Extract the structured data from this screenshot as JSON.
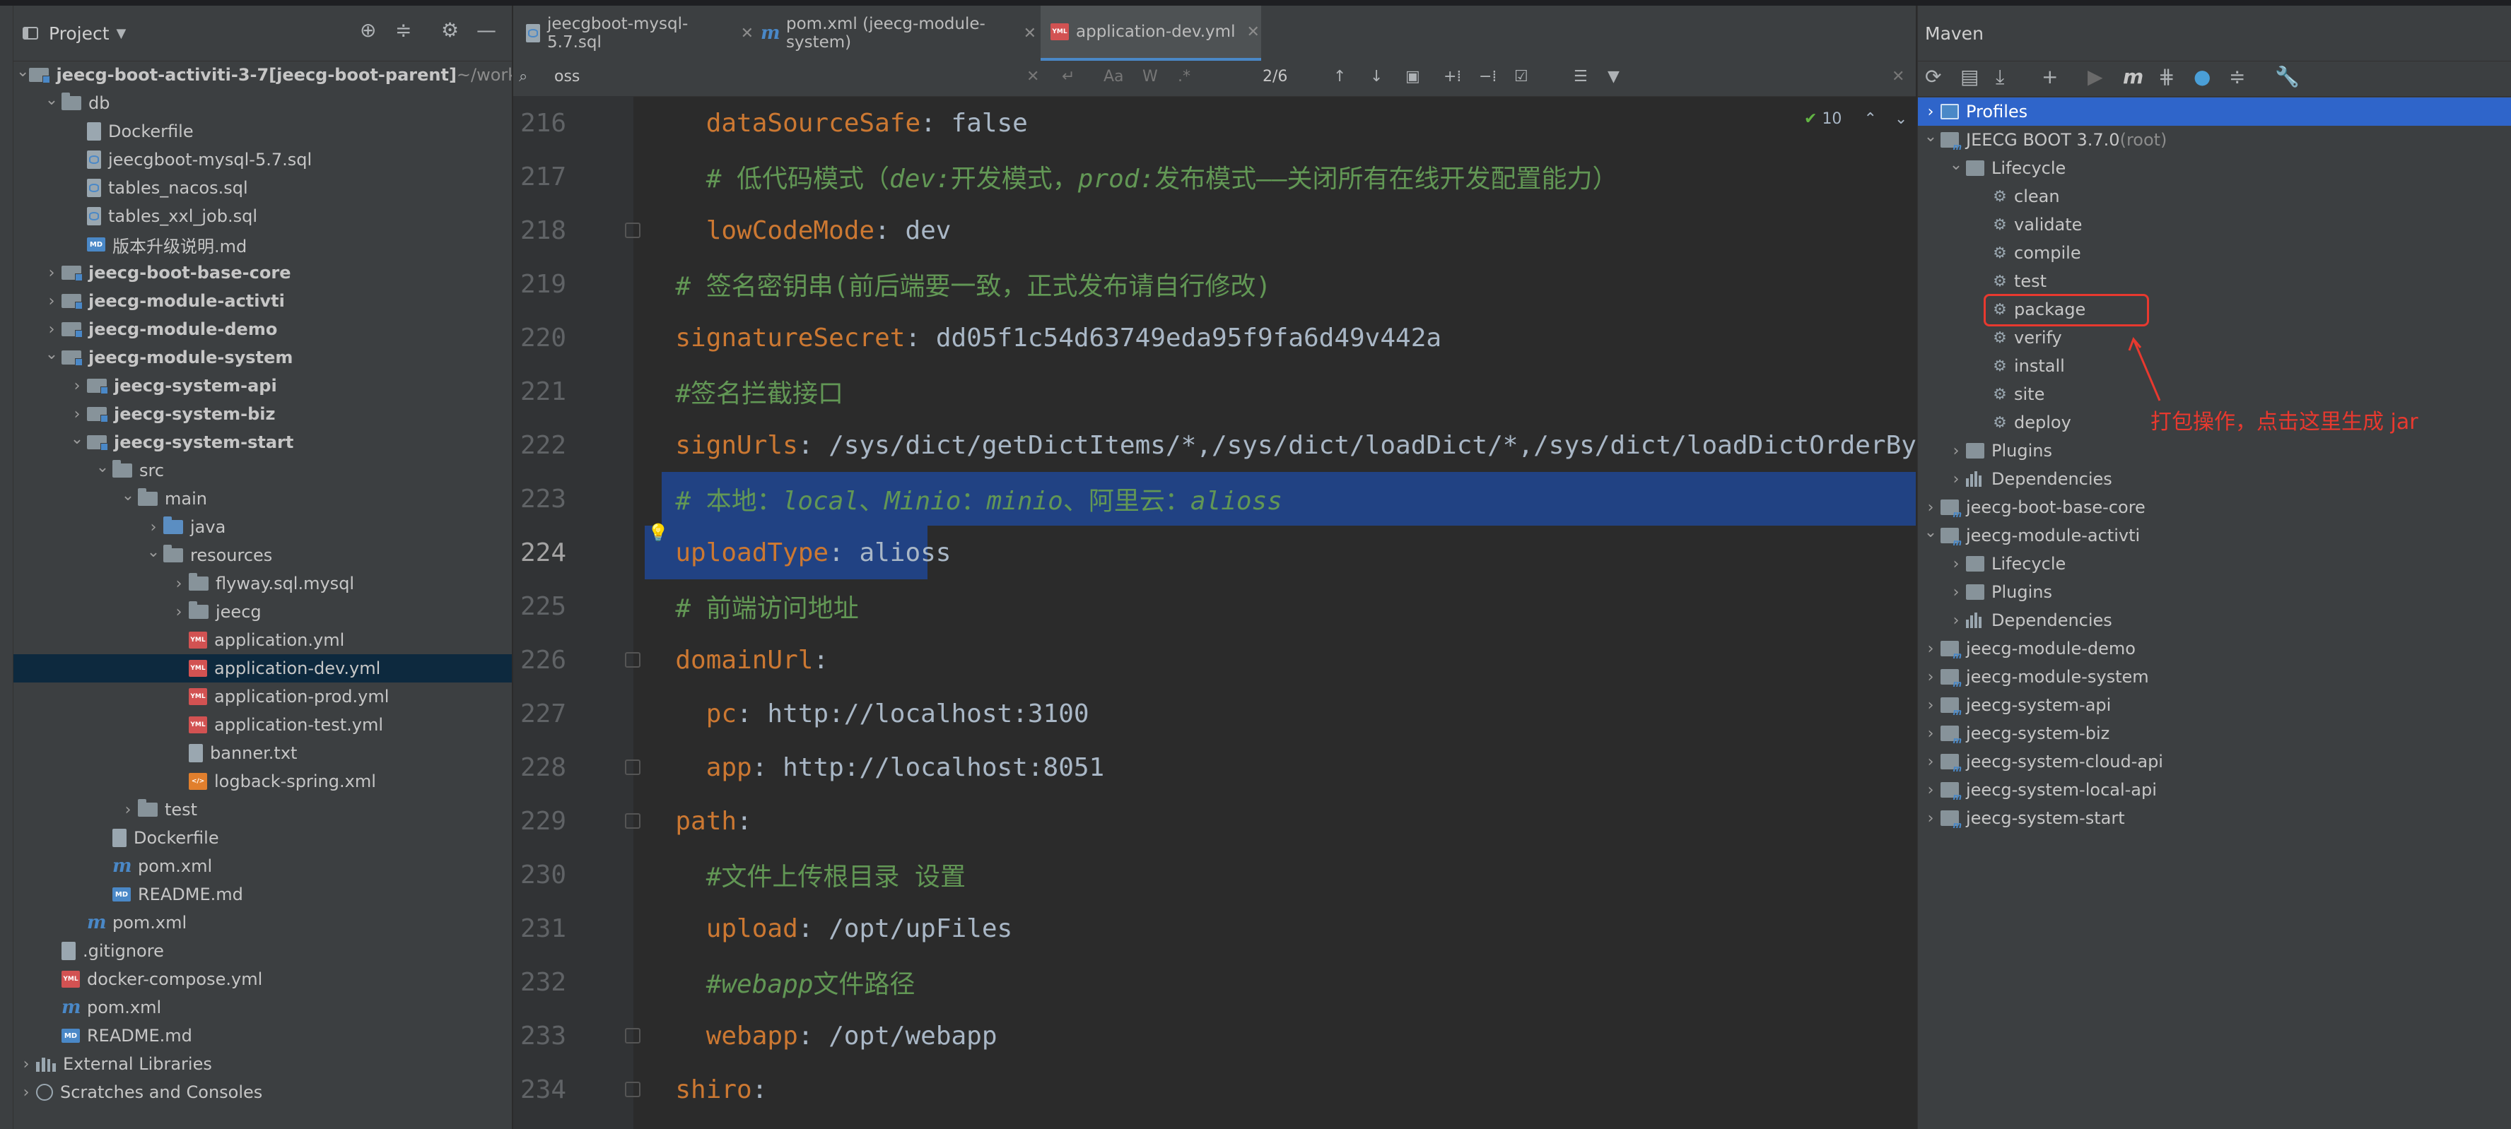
{
  "project_panel": {
    "title": "Project",
    "tree": [
      {
        "label": "jeecg-boot-activiti-3-7",
        "extra": " [jeecg-boot-parent]",
        "hint": " ~/worksp",
        "depth": 0,
        "arrow": "open",
        "icon": "module-folder",
        "bold": true
      },
      {
        "label": "db",
        "depth": 1,
        "arrow": "open",
        "icon": "folder"
      },
      {
        "label": "Dockerfile",
        "depth": 2,
        "arrow": "none",
        "icon": "file"
      },
      {
        "label": "jeecgboot-mysql-5.7.sql",
        "depth": 2,
        "arrow": "none",
        "icon": "sql-file"
      },
      {
        "label": "tables_nacos.sql",
        "depth": 2,
        "arrow": "none",
        "icon": "sql-file"
      },
      {
        "label": "tables_xxl_job.sql",
        "depth": 2,
        "arrow": "none",
        "icon": "sql-file"
      },
      {
        "label": "版本升级说明.md",
        "depth": 2,
        "arrow": "none",
        "icon": "md-file"
      },
      {
        "label": "jeecg-boot-base-core",
        "depth": 1,
        "arrow": "closed",
        "icon": "module-folder",
        "bold": true
      },
      {
        "label": "jeecg-module-activti",
        "depth": 1,
        "arrow": "closed",
        "icon": "module-folder",
        "bold": true
      },
      {
        "label": "jeecg-module-demo",
        "depth": 1,
        "arrow": "closed",
        "icon": "module-folder",
        "bold": true
      },
      {
        "label": "jeecg-module-system",
        "depth": 1,
        "arrow": "open",
        "icon": "module-folder",
        "bold": true
      },
      {
        "label": "jeecg-system-api",
        "depth": 2,
        "arrow": "closed",
        "icon": "module-folder",
        "bold": true
      },
      {
        "label": "jeecg-system-biz",
        "depth": 2,
        "arrow": "closed",
        "icon": "module-folder",
        "bold": true
      },
      {
        "label": "jeecg-system-start",
        "depth": 2,
        "arrow": "open",
        "icon": "module-folder",
        "bold": true
      },
      {
        "label": "src",
        "depth": 3,
        "arrow": "open",
        "icon": "folder"
      },
      {
        "label": "main",
        "depth": 4,
        "arrow": "open",
        "icon": "folder"
      },
      {
        "label": "java",
        "depth": 5,
        "arrow": "closed",
        "icon": "folder-blue"
      },
      {
        "label": "resources",
        "depth": 5,
        "arrow": "open",
        "icon": "folder"
      },
      {
        "label": "flyway.sql.mysql",
        "depth": 6,
        "arrow": "closed",
        "icon": "folder"
      },
      {
        "label": "jeecg",
        "depth": 6,
        "arrow": "closed",
        "icon": "folder"
      },
      {
        "label": "application.yml",
        "depth": 6,
        "arrow": "none",
        "icon": "yml-file"
      },
      {
        "label": "application-dev.yml",
        "depth": 6,
        "arrow": "none",
        "icon": "yml-file",
        "selected": true
      },
      {
        "label": "application-prod.yml",
        "depth": 6,
        "arrow": "none",
        "icon": "yml-file"
      },
      {
        "label": "application-test.yml",
        "depth": 6,
        "arrow": "none",
        "icon": "yml-file"
      },
      {
        "label": "banner.txt",
        "depth": 6,
        "arrow": "none",
        "icon": "txt-file"
      },
      {
        "label": "logback-spring.xml",
        "depth": 6,
        "arrow": "none",
        "icon": "xml-file"
      },
      {
        "label": "test",
        "depth": 4,
        "arrow": "closed",
        "icon": "folder"
      },
      {
        "label": "Dockerfile",
        "depth": 3,
        "arrow": "none",
        "icon": "file"
      },
      {
        "label": "pom.xml",
        "depth": 3,
        "arrow": "none",
        "icon": "maven-file"
      },
      {
        "label": "README.md",
        "depth": 3,
        "arrow": "none",
        "icon": "md-file"
      },
      {
        "label": "pom.xml",
        "depth": 2,
        "arrow": "none",
        "icon": "maven-file"
      },
      {
        "label": ".gitignore",
        "depth": 1,
        "arrow": "none",
        "icon": "file"
      },
      {
        "label": "docker-compose.yml",
        "depth": 1,
        "arrow": "none",
        "icon": "yml-file"
      },
      {
        "label": "pom.xml",
        "depth": 1,
        "arrow": "none",
        "icon": "maven-file"
      },
      {
        "label": "README.md",
        "depth": 1,
        "arrow": "none",
        "icon": "md-file"
      },
      {
        "label": "External Libraries",
        "depth": 0,
        "arrow": "closed",
        "icon": "library"
      },
      {
        "label": "Scratches and Consoles",
        "depth": 0,
        "arrow": "closed",
        "icon": "scratch"
      }
    ]
  },
  "editor": {
    "tabs": [
      {
        "label": "jeecgboot-mysql-5.7.sql",
        "icon": "sql-file",
        "active": false
      },
      {
        "label": "pom.xml (jeecg-module-system)",
        "icon": "maven-file",
        "active": false
      },
      {
        "label": "application-dev.yml",
        "icon": "yml-file",
        "active": true
      }
    ],
    "search": {
      "query": "oss",
      "match_count": "2/6"
    },
    "inspection_count": "10",
    "lines": [
      {
        "num": "216",
        "parts": [
          [
            "k",
            "    dataSourceSafe"
          ],
          [
            "v",
            ": false"
          ]
        ]
      },
      {
        "num": "217",
        "parts": [
          [
            "c",
            "    # 低代码模式（"
          ],
          [
            "ci",
            "dev:"
          ],
          [
            "c",
            "开发模式，"
          ],
          [
            "ci",
            "prod:"
          ],
          [
            "c",
            "发布模式——关闭所有在线开发配置能力）"
          ]
        ]
      },
      {
        "num": "218",
        "parts": [
          [
            "k",
            "    lowCodeMode"
          ],
          [
            "v",
            ": dev"
          ]
        ],
        "fold": true
      },
      {
        "num": "219",
        "parts": [
          [
            "c",
            "  # 签名密钥串(前后端要一致，正式发布请自行修改)"
          ]
        ]
      },
      {
        "num": "220",
        "parts": [
          [
            "k",
            "  signatureSecret"
          ],
          [
            "v",
            ": dd05f1c54d63749eda95f9fa6d49v442a"
          ]
        ]
      },
      {
        "num": "221",
        "parts": [
          [
            "c",
            "  #签名拦截接口"
          ]
        ]
      },
      {
        "num": "222",
        "parts": [
          [
            "k",
            "  signUrls"
          ],
          [
            "v",
            ": /sys/dict/getDictItems/*,/sys/dict/loadDict/*,/sys/dict/loadDictOrderBy"
          ]
        ]
      },
      {
        "num": "223",
        "parts": [
          [
            "c",
            "  # 本地："
          ],
          [
            "ci",
            "local"
          ],
          [
            "c",
            "、"
          ],
          [
            "ci",
            "Minio"
          ],
          [
            "c",
            "："
          ],
          [
            "ci",
            "minio"
          ],
          [
            "c",
            "、阿里云："
          ],
          [
            "ci",
            "alioss"
          ]
        ],
        "highlight": "full"
      },
      {
        "num": "224",
        "parts": [
          [
            "k",
            "  uploadType"
          ],
          [
            "v",
            ": alioss"
          ]
        ],
        "highlight": "partial",
        "current": true
      },
      {
        "num": "225",
        "parts": [
          [
            "c",
            "  # 前端访问地址"
          ]
        ]
      },
      {
        "num": "226",
        "parts": [
          [
            "k",
            "  domainUrl"
          ],
          [
            "v",
            ":"
          ]
        ],
        "fold": true
      },
      {
        "num": "227",
        "parts": [
          [
            "k",
            "    pc"
          ],
          [
            "v",
            ": http://localhost:3100"
          ]
        ]
      },
      {
        "num": "228",
        "parts": [
          [
            "k",
            "    app"
          ],
          [
            "v",
            ": http://localhost:8051"
          ]
        ],
        "fold": true
      },
      {
        "num": "229",
        "parts": [
          [
            "k",
            "  path"
          ],
          [
            "v",
            ":"
          ]
        ],
        "fold": true
      },
      {
        "num": "230",
        "parts": [
          [
            "c",
            "    #文件上传根目录 设置"
          ]
        ]
      },
      {
        "num": "231",
        "parts": [
          [
            "k",
            "    upload"
          ],
          [
            "v",
            ": /opt/upFiles"
          ]
        ]
      },
      {
        "num": "232",
        "parts": [
          [
            "c",
            "    #"
          ],
          [
            "ci",
            "webapp"
          ],
          [
            "c",
            "文件路径"
          ]
        ]
      },
      {
        "num": "233",
        "parts": [
          [
            "k",
            "    webapp"
          ],
          [
            "v",
            ": /opt/webapp"
          ]
        ],
        "fold": true
      },
      {
        "num": "234",
        "parts": [
          [
            "k",
            "  shiro"
          ],
          [
            "v",
            ":"
          ]
        ],
        "fold": true
      }
    ]
  },
  "maven_panel": {
    "title": "Maven",
    "tree": [
      {
        "label": "Profiles",
        "depth": 0,
        "arrow": "closed",
        "icon": "profiles",
        "selected": true
      },
      {
        "label": "JEECG BOOT 3.7.0",
        "hint": " (root)",
        "depth": 0,
        "arrow": "open",
        "icon": "maven-module"
      },
      {
        "label": "Lifecycle",
        "depth": 1,
        "arrow": "open",
        "icon": "plugin-folder"
      },
      {
        "label": "clean",
        "depth": 2,
        "arrow": "none",
        "icon": "gear"
      },
      {
        "label": "validate",
        "depth": 2,
        "arrow": "none",
        "icon": "gear"
      },
      {
        "label": "compile",
        "depth": 2,
        "arrow": "none",
        "icon": "gear"
      },
      {
        "label": "test",
        "depth": 2,
        "arrow": "none",
        "icon": "gear"
      },
      {
        "label": "package",
        "depth": 2,
        "arrow": "none",
        "icon": "gear"
      },
      {
        "label": "verify",
        "depth": 2,
        "arrow": "none",
        "icon": "gear"
      },
      {
        "label": "install",
        "depth": 2,
        "arrow": "none",
        "icon": "gear"
      },
      {
        "label": "site",
        "depth": 2,
        "arrow": "none",
        "icon": "gear"
      },
      {
        "label": "deploy",
        "depth": 2,
        "arrow": "none",
        "icon": "gear"
      },
      {
        "label": "Plugins",
        "depth": 1,
        "arrow": "closed",
        "icon": "plugin-folder"
      },
      {
        "label": "Dependencies",
        "depth": 1,
        "arrow": "closed",
        "icon": "dependencies"
      },
      {
        "label": "jeecg-boot-base-core",
        "depth": 0,
        "arrow": "closed",
        "icon": "maven-module"
      },
      {
        "label": "jeecg-module-activti",
        "depth": 0,
        "arrow": "open",
        "icon": "maven-module"
      },
      {
        "label": "Lifecycle",
        "depth": 1,
        "arrow": "closed",
        "icon": "plugin-folder"
      },
      {
        "label": "Plugins",
        "depth": 1,
        "arrow": "closed",
        "icon": "plugin-folder"
      },
      {
        "label": "Dependencies",
        "depth": 1,
        "arrow": "closed",
        "icon": "dependencies"
      },
      {
        "label": "jeecg-module-demo",
        "depth": 0,
        "arrow": "closed",
        "icon": "maven-module"
      },
      {
        "label": "jeecg-module-system",
        "depth": 0,
        "arrow": "closed",
        "icon": "maven-module"
      },
      {
        "label": "jeecg-system-api",
        "depth": 0,
        "arrow": "closed",
        "icon": "maven-module"
      },
      {
        "label": "jeecg-system-biz",
        "depth": 0,
        "arrow": "closed",
        "icon": "maven-module"
      },
      {
        "label": "jeecg-system-cloud-api",
        "depth": 0,
        "arrow": "closed",
        "icon": "maven-module"
      },
      {
        "label": "jeecg-system-local-api",
        "depth": 0,
        "arrow": "closed",
        "icon": "maven-module"
      },
      {
        "label": "jeecg-system-start",
        "depth": 0,
        "arrow": "closed",
        "icon": "maven-module"
      }
    ]
  },
  "annotation": {
    "text": "打包操作，点击这里生成 jar",
    "color": "#e8392f"
  },
  "colors": {
    "selection": "#214283",
    "keyword": "#cc7832",
    "comment": "#629755",
    "tree_selected": "#0d293e",
    "maven_selected": "#2f65ca"
  }
}
